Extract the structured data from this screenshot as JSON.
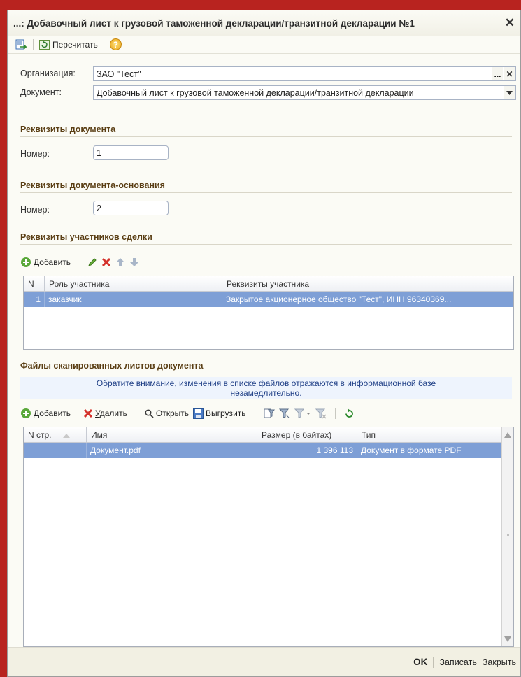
{
  "window": {
    "title": "...: Добавочный лист к грузовой таможенной декларации/транзитной декларации №1",
    "close": "✕"
  },
  "toolbar": {
    "reread_label": "Перечитать",
    "help": "?"
  },
  "form": {
    "org_label": "Организация:",
    "org_value": "ЗАО \"Тест\"",
    "org_select_btn": "...",
    "org_clear_btn": "✕",
    "doc_label": "Документ:",
    "doc_value": "Добавочный лист к грузовой таможенной декларации/транзитной декларации"
  },
  "sections": {
    "doc_requisites": "Реквизиты документа",
    "number_label": "Номер:",
    "number_value": "1",
    "base_requisites": "Реквизиты документа-основания",
    "base_number_label": "Номер:",
    "base_number_value": "2",
    "participants": "Реквизиты участников сделки",
    "files": "Файлы сканированных листов документа"
  },
  "participants_bar": {
    "add": "Добавить"
  },
  "participants_grid": {
    "columns": [
      "N",
      "Роль участника",
      "Реквизиты участника"
    ],
    "rows": [
      {
        "n": "1",
        "role": "заказчик",
        "details": "Закрытое акционерное общество \"Тест\", ИНН 96340369..."
      }
    ]
  },
  "info_banner": {
    "line1": "Обратите внимание, изменения в списке файлов отражаются в информационной базе",
    "line2": "незамедлительно."
  },
  "files_bar": {
    "add": "Добавить",
    "delete": "Удалить",
    "open": "Открыть",
    "export": "Выгрузить"
  },
  "files_grid": {
    "columns": [
      "N стр.",
      "Имя",
      "Размер (в байтах)",
      "Тип"
    ],
    "rows": [
      {
        "n": "",
        "name": "Документ.pdf",
        "size": "1 396 113",
        "type": "Документ в формате PDF"
      }
    ]
  },
  "footer": {
    "ok": "OK",
    "save": "Записать",
    "close": "Закрыть"
  },
  "colors": {
    "accent_border": "#b8231f",
    "selection": "#7e9fd6",
    "section_title": "#5a3e14"
  }
}
